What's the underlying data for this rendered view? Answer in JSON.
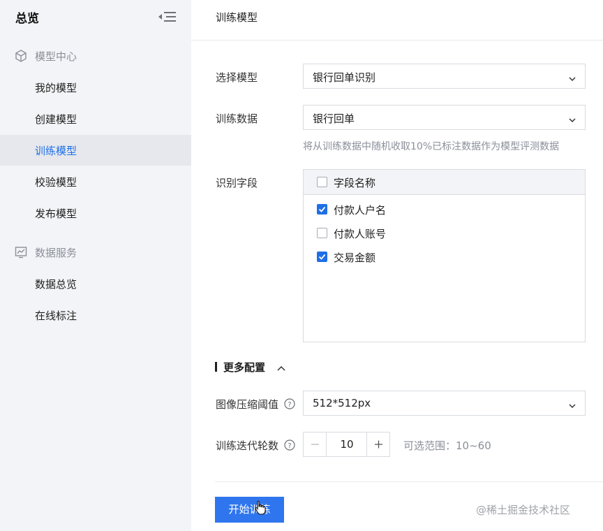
{
  "sidebar": {
    "title": "总览",
    "groups": [
      {
        "label": "模型中心",
        "icon": "cube-icon",
        "items": [
          {
            "label": "我的模型"
          },
          {
            "label": "创建模型"
          },
          {
            "label": "训练模型",
            "active": true
          },
          {
            "label": "校验模型"
          },
          {
            "label": "发布模型"
          }
        ]
      },
      {
        "label": "数据服务",
        "icon": "chart-icon",
        "items": [
          {
            "label": "数据总览"
          },
          {
            "label": "在线标注"
          }
        ]
      }
    ]
  },
  "main": {
    "title": "训练模型",
    "model": {
      "label": "选择模型",
      "value": "银行回单识别"
    },
    "data": {
      "label": "训练数据",
      "value": "银行回单",
      "hint": "将从训练数据中随机收取10%已标注数据作为模型评测数据"
    },
    "fields": {
      "label": "识别字段",
      "header": "字段名称",
      "items": [
        {
          "name": "付款人户名",
          "checked": true
        },
        {
          "name": "付款人账号",
          "checked": false
        },
        {
          "name": "交易金额",
          "checked": true
        }
      ]
    },
    "more": {
      "title": "更多配置",
      "compression": {
        "label": "图像压缩阈值",
        "value": "512*512px"
      },
      "epochs": {
        "label": "训练迭代轮数",
        "value": "10",
        "range": "可选范围：10~60"
      }
    },
    "start_label": "开始训练"
  },
  "watermark": "@稀土掘金技术社区",
  "colors": {
    "primary": "#2f76ee",
    "active_text": "#1f6fe6",
    "sidebar_bg": "#f3f4f7",
    "muted": "#8a8f99"
  }
}
